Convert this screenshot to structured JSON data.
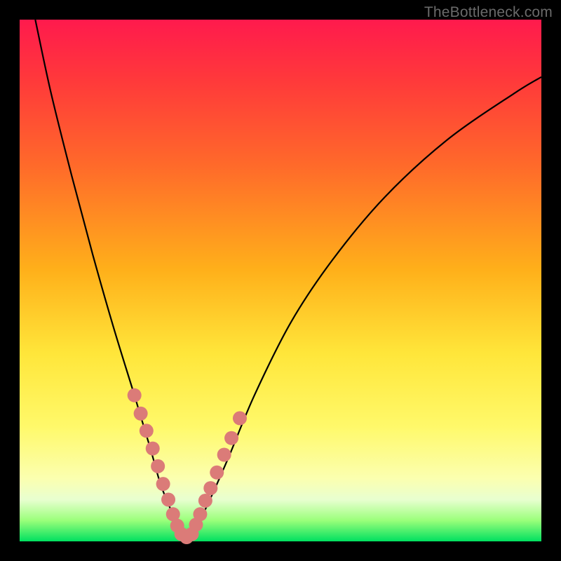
{
  "attribution": "TheBottleneck.com",
  "colors": {
    "frame_bg_top": "#ff1a4d",
    "frame_bg_mid": "#ffe63a",
    "frame_bg_bottom": "#00e060",
    "curve": "#000000",
    "marker": "#db7b78",
    "page_bg": "#000000",
    "attribution_text": "#6a6a6a"
  },
  "chart_data": {
    "type": "line",
    "title": "",
    "xlabel": "",
    "ylabel": "",
    "xlim": [
      0,
      100
    ],
    "ylim": [
      0,
      100
    ],
    "grid": false,
    "legend": false,
    "series": [
      {
        "name": "bottleneck-curve",
        "x": [
          3,
          6,
          10,
          14,
          18,
          22,
          25,
          27,
          29,
          30.5,
          32,
          33.5,
          36,
          40,
          45,
          52,
          60,
          70,
          82,
          95,
          100
        ],
        "y": [
          100,
          86,
          70,
          55,
          41,
          28,
          18,
          11,
          6,
          2.5,
          0.8,
          2.2,
          7,
          16,
          28,
          42,
          54,
          66,
          77,
          86,
          89
        ]
      }
    ],
    "markers": {
      "name": "highlight-points",
      "x": [
        22,
        23.2,
        24.3,
        25.5,
        26.5,
        27.5,
        28.5,
        29.4,
        30.2,
        31,
        32,
        33,
        33.8,
        34.6,
        35.6,
        36.6,
        37.8,
        39.2,
        40.6,
        42.2
      ],
      "y": [
        28,
        24.5,
        21.2,
        17.8,
        14.4,
        11,
        8,
        5.2,
        3,
        1.4,
        0.8,
        1.4,
        3.2,
        5.2,
        7.8,
        10.2,
        13.2,
        16.6,
        19.8,
        23.6
      ],
      "radius": 10
    }
  }
}
